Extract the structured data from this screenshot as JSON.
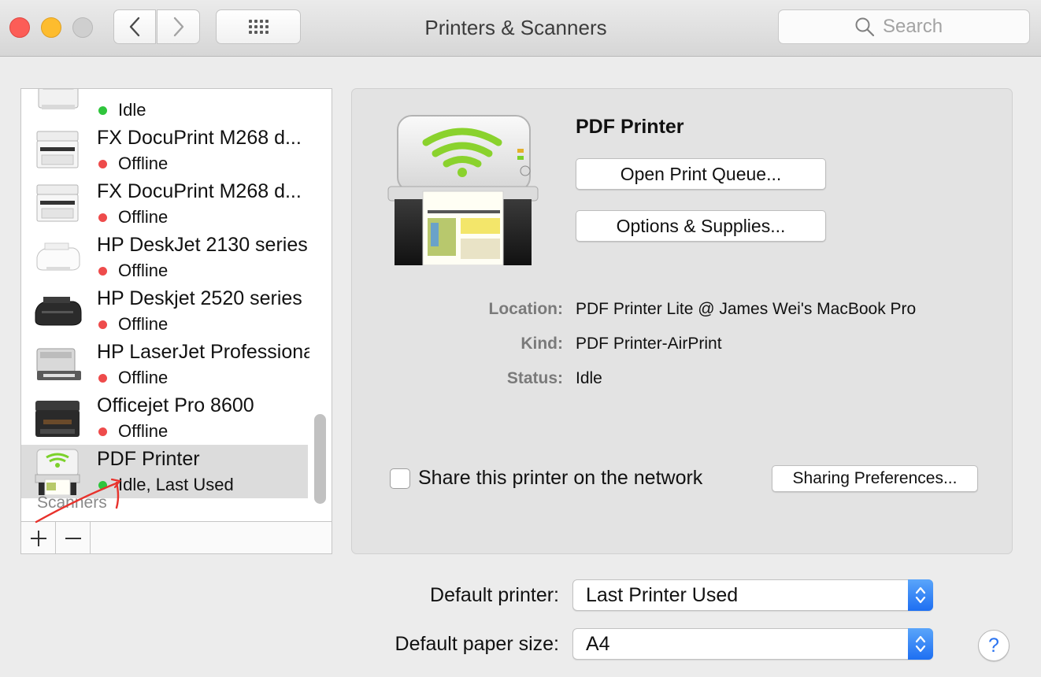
{
  "window": {
    "title": "Printers & Scanners",
    "search_placeholder": "Search"
  },
  "icons": {
    "close": "close-icon",
    "minimize": "minimize-icon",
    "zoom": "zoom-icon",
    "back": "chevron-left-icon",
    "forward": "chevron-right-icon",
    "show_all": "grid-icon",
    "search": "search-icon",
    "popup_arrows": "chevron-updown-icon",
    "help": "question-icon"
  },
  "colors": {
    "status_green": "#2fc53c",
    "status_red": "#ee4b4b",
    "accent_blue": "#2a73f0",
    "annotation_red": "#e8322c"
  },
  "printers": [
    {
      "name": "",
      "status": "Idle",
      "status_color": "green",
      "icon": "laser-printer-icon"
    },
    {
      "name": "FX DocuPrint M268 d...",
      "status": "Offline",
      "status_color": "red",
      "icon": "multifunction-printer-icon"
    },
    {
      "name": "FX DocuPrint M268 d...",
      "status": "Offline",
      "status_color": "red",
      "icon": "multifunction-printer-icon"
    },
    {
      "name": "HP DeskJet 2130 series",
      "status": "Offline",
      "status_color": "red",
      "icon": "inkjet-printer-icon"
    },
    {
      "name": "HP Deskjet 2520 series",
      "status": "Offline",
      "status_color": "red",
      "icon": "inkjet-printer-dark-icon"
    },
    {
      "name": "HP LaserJet Professional",
      "status": "Offline",
      "status_color": "red",
      "icon": "laser-printer-icon"
    },
    {
      "name": "Officejet Pro 8600",
      "status": "Offline",
      "status_color": "red",
      "icon": "officejet-printer-icon"
    },
    {
      "name": "PDF Printer",
      "status": "Idle, Last Used",
      "status_color": "green",
      "icon": "pdf-printer-icon",
      "selected": true
    }
  ],
  "list": {
    "scanners_label": "Scanners",
    "add_label": "+",
    "remove_label": "—"
  },
  "detail": {
    "title": "PDF Printer",
    "open_queue_label": "Open Print Queue...",
    "options_label": "Options & Supplies...",
    "location_label": "Location:",
    "location_value": "PDF Printer Lite @ James Wei's MacBook Pro",
    "kind_label": "Kind:",
    "kind_value": "PDF Printer-AirPrint",
    "status_label": "Status:",
    "status_value": "Idle",
    "share_label": "Share this printer on the network",
    "share_checked": false,
    "sharing_prefs_label": "Sharing Preferences..."
  },
  "defaults": {
    "default_printer_label": "Default printer:",
    "default_printer_value": "Last Printer Used",
    "paper_size_label": "Default paper size:",
    "paper_size_value": "A4"
  },
  "help_label": "?"
}
